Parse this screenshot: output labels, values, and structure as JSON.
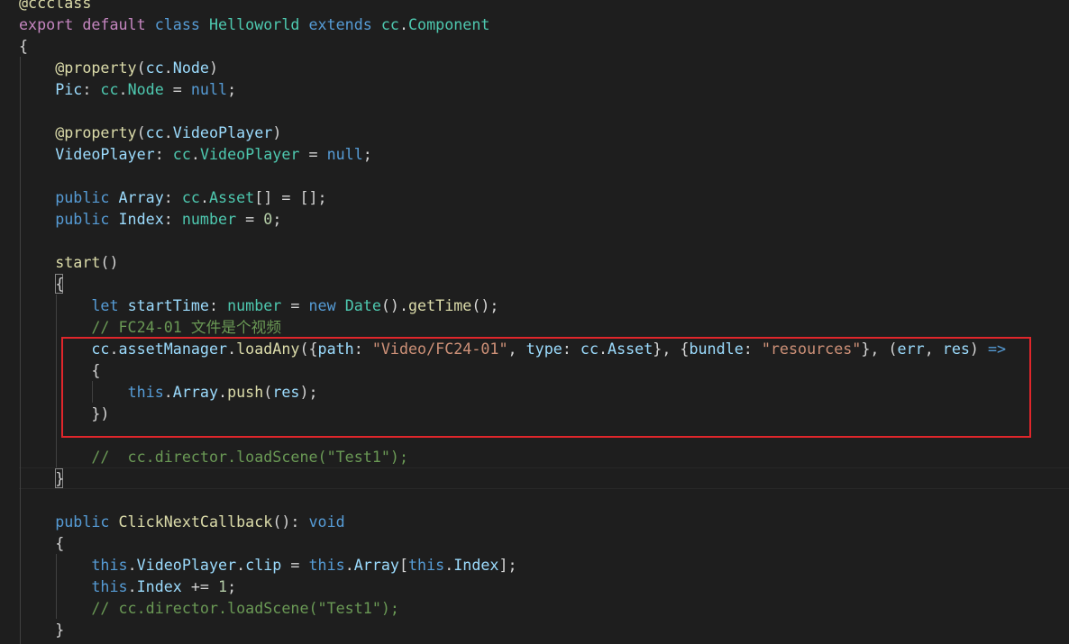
{
  "colors": {
    "background": "#1e1e1e",
    "highlight_border": "#e0262b",
    "keyword": "#569cd6",
    "control_keyword": "#c586c0",
    "type": "#4ec9b0",
    "variable": "#9cdcfe",
    "function": "#dcdcaa",
    "string": "#ce9178",
    "number": "#b5cea8",
    "comment": "#6a9955",
    "punctuation": "#d4d4d4"
  },
  "code_lines": [
    [
      [
        "@ccclass",
        "function"
      ]
    ],
    [
      [
        "export",
        "control_keyword"
      ],
      [
        " ",
        "punctuation"
      ],
      [
        "default",
        "control_keyword"
      ],
      [
        " ",
        "punctuation"
      ],
      [
        "class",
        "keyword"
      ],
      [
        " ",
        "punctuation"
      ],
      [
        "Helloworld",
        "type"
      ],
      [
        " ",
        "punctuation"
      ],
      [
        "extends",
        "keyword"
      ],
      [
        " ",
        "punctuation"
      ],
      [
        "cc",
        "type"
      ],
      [
        ".",
        "punctuation"
      ],
      [
        "Component",
        "type"
      ]
    ],
    [
      [
        "{",
        "punctuation"
      ]
    ],
    [
      [
        "    ",
        "punctuation"
      ],
      [
        "@property",
        "function"
      ],
      [
        "(",
        "punctuation"
      ],
      [
        "cc",
        "variable"
      ],
      [
        ".",
        "punctuation"
      ],
      [
        "Node",
        "variable"
      ],
      [
        ")",
        "punctuation"
      ]
    ],
    [
      [
        "    ",
        "punctuation"
      ],
      [
        "Pic",
        "variable"
      ],
      [
        ": ",
        "punctuation"
      ],
      [
        "cc",
        "type"
      ],
      [
        ".",
        "punctuation"
      ],
      [
        "Node",
        "type"
      ],
      [
        " = ",
        "punctuation"
      ],
      [
        "null",
        "keyword"
      ],
      [
        ";",
        "punctuation"
      ]
    ],
    [],
    [
      [
        "    ",
        "punctuation"
      ],
      [
        "@property",
        "function"
      ],
      [
        "(",
        "punctuation"
      ],
      [
        "cc",
        "variable"
      ],
      [
        ".",
        "punctuation"
      ],
      [
        "VideoPlayer",
        "variable"
      ],
      [
        ")",
        "punctuation"
      ]
    ],
    [
      [
        "    ",
        "punctuation"
      ],
      [
        "VideoPlayer",
        "variable"
      ],
      [
        ": ",
        "punctuation"
      ],
      [
        "cc",
        "type"
      ],
      [
        ".",
        "punctuation"
      ],
      [
        "VideoPlayer",
        "type"
      ],
      [
        " = ",
        "punctuation"
      ],
      [
        "null",
        "keyword"
      ],
      [
        ";",
        "punctuation"
      ]
    ],
    [],
    [
      [
        "    ",
        "punctuation"
      ],
      [
        "public",
        "keyword"
      ],
      [
        " ",
        "punctuation"
      ],
      [
        "Array",
        "variable"
      ],
      [
        ": ",
        "punctuation"
      ],
      [
        "cc",
        "type"
      ],
      [
        ".",
        "punctuation"
      ],
      [
        "Asset",
        "type"
      ],
      [
        "[] = [];",
        "punctuation"
      ]
    ],
    [
      [
        "    ",
        "punctuation"
      ],
      [
        "public",
        "keyword"
      ],
      [
        " ",
        "punctuation"
      ],
      [
        "Index",
        "variable"
      ],
      [
        ": ",
        "punctuation"
      ],
      [
        "number",
        "type"
      ],
      [
        " = ",
        "punctuation"
      ],
      [
        "0",
        "number"
      ],
      [
        ";",
        "punctuation"
      ]
    ],
    [],
    [
      [
        "    ",
        "punctuation"
      ],
      [
        "start",
        "function"
      ],
      [
        "()",
        "punctuation"
      ]
    ],
    [
      [
        "    ",
        "punctuation"
      ],
      [
        "{",
        "punctuation"
      ]
    ],
    [
      [
        "        ",
        "punctuation"
      ],
      [
        "let",
        "keyword"
      ],
      [
        " ",
        "punctuation"
      ],
      [
        "startTime",
        "variable"
      ],
      [
        ": ",
        "punctuation"
      ],
      [
        "number",
        "type"
      ],
      [
        " = ",
        "punctuation"
      ],
      [
        "new",
        "keyword"
      ],
      [
        " ",
        "punctuation"
      ],
      [
        "Date",
        "type"
      ],
      [
        "().",
        "punctuation"
      ],
      [
        "getTime",
        "function"
      ],
      [
        "();",
        "punctuation"
      ]
    ],
    [
      [
        "        ",
        "punctuation"
      ],
      [
        "// FC24-01 文件是个视频",
        "comment"
      ]
    ],
    [
      [
        "        ",
        "punctuation"
      ],
      [
        "cc",
        "variable"
      ],
      [
        ".",
        "punctuation"
      ],
      [
        "assetManager",
        "variable"
      ],
      [
        ".",
        "punctuation"
      ],
      [
        "loadAny",
        "function"
      ],
      [
        "({",
        "punctuation"
      ],
      [
        "path",
        "variable"
      ],
      [
        ": ",
        "punctuation"
      ],
      [
        "\"Video/FC24-01\"",
        "string"
      ],
      [
        ", ",
        "punctuation"
      ],
      [
        "type",
        "variable"
      ],
      [
        ": ",
        "punctuation"
      ],
      [
        "cc",
        "variable"
      ],
      [
        ".",
        "punctuation"
      ],
      [
        "Asset",
        "variable"
      ],
      [
        "}, {",
        "punctuation"
      ],
      [
        "bundle",
        "variable"
      ],
      [
        ": ",
        "punctuation"
      ],
      [
        "\"resources\"",
        "string"
      ],
      [
        "}, (",
        "punctuation"
      ],
      [
        "err",
        "variable"
      ],
      [
        ", ",
        "punctuation"
      ],
      [
        "res",
        "variable"
      ],
      [
        ") ",
        "punctuation"
      ],
      [
        "=>",
        "keyword"
      ]
    ],
    [
      [
        "        ",
        "punctuation"
      ],
      [
        "{",
        "punctuation"
      ]
    ],
    [
      [
        "            ",
        "punctuation"
      ],
      [
        "this",
        "keyword"
      ],
      [
        ".",
        "punctuation"
      ],
      [
        "Array",
        "variable"
      ],
      [
        ".",
        "punctuation"
      ],
      [
        "push",
        "function"
      ],
      [
        "(",
        "punctuation"
      ],
      [
        "res",
        "variable"
      ],
      [
        ");",
        "punctuation"
      ]
    ],
    [
      [
        "        ",
        "punctuation"
      ],
      [
        "})",
        "punctuation"
      ]
    ],
    [],
    [
      [
        "        ",
        "punctuation"
      ],
      [
        "//  cc.director.loadScene(\"Test1\");",
        "comment"
      ]
    ],
    [
      [
        "    ",
        "punctuation"
      ],
      [
        "}",
        "punctuation"
      ]
    ],
    [],
    [
      [
        "    ",
        "punctuation"
      ],
      [
        "public",
        "keyword"
      ],
      [
        " ",
        "punctuation"
      ],
      [
        "ClickNextCallback",
        "function"
      ],
      [
        "(): ",
        "punctuation"
      ],
      [
        "void",
        "keyword"
      ]
    ],
    [
      [
        "    ",
        "punctuation"
      ],
      [
        "{",
        "punctuation"
      ]
    ],
    [
      [
        "        ",
        "punctuation"
      ],
      [
        "this",
        "keyword"
      ],
      [
        ".",
        "punctuation"
      ],
      [
        "VideoPlayer",
        "variable"
      ],
      [
        ".",
        "punctuation"
      ],
      [
        "clip",
        "variable"
      ],
      [
        " = ",
        "punctuation"
      ],
      [
        "this",
        "keyword"
      ],
      [
        ".",
        "punctuation"
      ],
      [
        "Array",
        "variable"
      ],
      [
        "[",
        "punctuation"
      ],
      [
        "this",
        "keyword"
      ],
      [
        ".",
        "punctuation"
      ],
      [
        "Index",
        "variable"
      ],
      [
        "];",
        "punctuation"
      ]
    ],
    [
      [
        "        ",
        "punctuation"
      ],
      [
        "this",
        "keyword"
      ],
      [
        ".",
        "punctuation"
      ],
      [
        "Index",
        "variable"
      ],
      [
        " += ",
        "punctuation"
      ],
      [
        "1",
        "number"
      ],
      [
        ";",
        "punctuation"
      ]
    ],
    [
      [
        "        ",
        "punctuation"
      ],
      [
        "// cc.director.loadScene(\"Test1\");",
        "comment"
      ]
    ],
    [
      [
        "    ",
        "punctuation"
      ],
      [
        "}",
        "punctuation"
      ]
    ]
  ]
}
